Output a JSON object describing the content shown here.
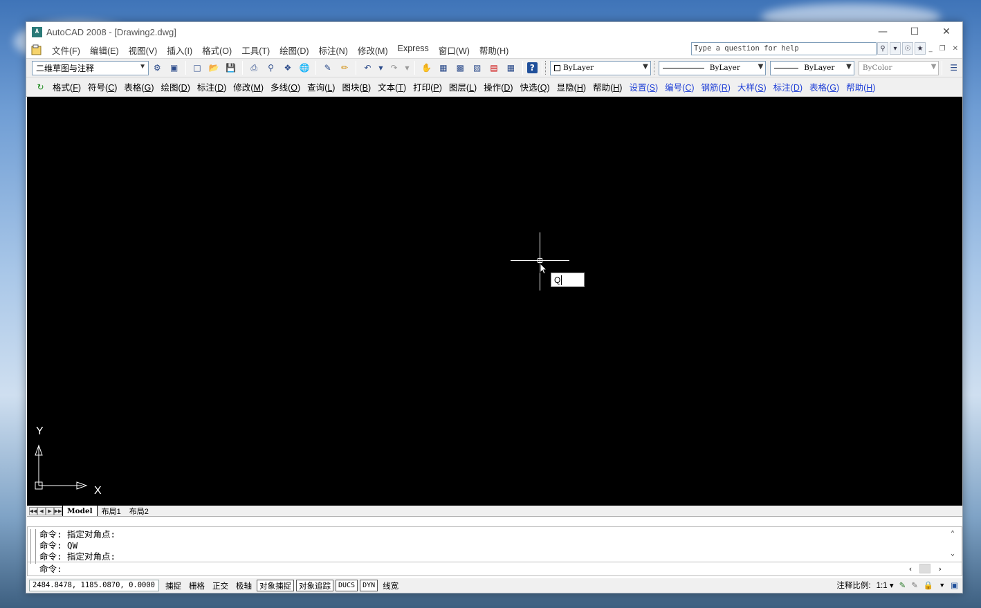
{
  "window": {
    "title": "AutoCAD 2008 - [Drawing2.dwg]",
    "logo_text": "A"
  },
  "menubar": {
    "items": [
      "文件(F)",
      "编辑(E)",
      "视图(V)",
      "插入(I)",
      "格式(O)",
      "工具(T)",
      "绘图(D)",
      "标注(N)",
      "修改(M)",
      "Express",
      "窗口(W)",
      "帮助(H)"
    ],
    "help_placeholder": "Type a question for help"
  },
  "toolbar1": {
    "workspace": "二维草图与注释",
    "color_combo": "ByLayer",
    "linetype_combo": "ByLayer",
    "lineweight_combo": "ByLayer",
    "plotstyle_combo": "ByColor"
  },
  "toolbar2": {
    "items": [
      {
        "label": "格式",
        "key": "F",
        "blue": false
      },
      {
        "label": "符号",
        "key": "C",
        "blue": false
      },
      {
        "label": "表格",
        "key": "G",
        "blue": false
      },
      {
        "label": "绘图",
        "key": "D",
        "blue": false
      },
      {
        "label": "标注",
        "key": "D",
        "blue": false
      },
      {
        "label": "修改",
        "key": "M",
        "blue": false
      },
      {
        "label": "多线",
        "key": "O",
        "blue": false
      },
      {
        "label": "查询",
        "key": "L",
        "blue": false
      },
      {
        "label": "图块",
        "key": "B",
        "blue": false
      },
      {
        "label": "文本",
        "key": "T",
        "blue": false
      },
      {
        "label": "打印",
        "key": "P",
        "blue": false
      },
      {
        "label": "图层",
        "key": "L",
        "blue": false
      },
      {
        "label": "操作",
        "key": "D",
        "blue": false
      },
      {
        "label": "快选",
        "key": "Q",
        "blue": false
      },
      {
        "label": "显隐",
        "key": "H",
        "blue": false
      },
      {
        "label": "帮助",
        "key": "H",
        "blue": false
      },
      {
        "label": "设置",
        "key": "S",
        "blue": true
      },
      {
        "label": "编号",
        "key": "C",
        "blue": true
      },
      {
        "label": "钢筋",
        "key": "R",
        "blue": true
      },
      {
        "label": "大样",
        "key": "S",
        "blue": true
      },
      {
        "label": "标注",
        "key": "D",
        "blue": true
      },
      {
        "label": "表格",
        "key": "G",
        "blue": true
      },
      {
        "label": "帮助",
        "key": "H",
        "blue": true
      }
    ]
  },
  "canvas": {
    "dynamic_input_value": "Q",
    "ucs_x": "X",
    "ucs_y": "Y"
  },
  "tabs": {
    "model": "Model",
    "layout1": "布局1",
    "layout2": "布局2"
  },
  "command": {
    "history": [
      "命令: 指定对角点:",
      "命令: QW",
      "命令: 指定对角点:"
    ],
    "prompt": "命令:"
  },
  "statusbar": {
    "coords": "2484.8478, 1185.0870, 0.0000",
    "buttons": [
      {
        "label": "捕捉",
        "on": false,
        "mono": false
      },
      {
        "label": "栅格",
        "on": false,
        "mono": false
      },
      {
        "label": "正交",
        "on": false,
        "mono": false
      },
      {
        "label": "极轴",
        "on": false,
        "mono": false
      },
      {
        "label": "对象捕捉",
        "on": true,
        "mono": false
      },
      {
        "label": "对象追踪",
        "on": true,
        "mono": false
      },
      {
        "label": "DUCS",
        "on": true,
        "mono": true
      },
      {
        "label": "DYN",
        "on": true,
        "mono": true
      },
      {
        "label": "线宽",
        "on": false,
        "mono": false
      }
    ],
    "annotation_scale_label": "注释比例:",
    "annotation_scale_value": "1:1"
  }
}
